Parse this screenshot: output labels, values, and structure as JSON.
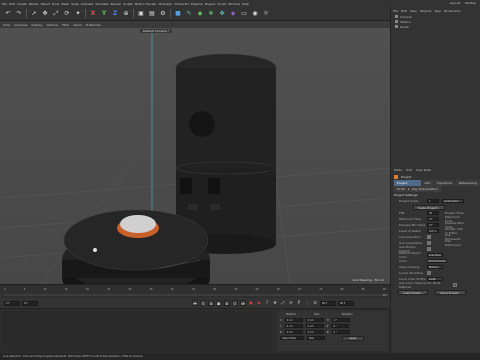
{
  "menubar": {
    "items": [
      "File",
      "Edit",
      "Create",
      "Modes",
      "Select",
      "Tools",
      "Mesh",
      "Snap",
      "Animate",
      "Simulate",
      "Render",
      "Sculpt",
      "Motion Tracker",
      "MoGraph",
      "Character",
      "Pipeline",
      "Plugins",
      "Script",
      "Window",
      "Help"
    ],
    "layout_label": "Layout:",
    "layout_value": "Startup"
  },
  "toolbar": {
    "icons": [
      "undo-icon",
      "redo-icon",
      "live-selection-icon",
      "move-icon",
      "scale-icon",
      "rotate-icon",
      "recent-tools-icon",
      "x-axis-icon",
      "y-axis-icon",
      "z-axis-icon",
      "coordinate-system-icon",
      "render-view-icon",
      "render-picture-viewer-icon",
      "edit-render-settings-icon",
      "cube-icon",
      "pen-icon",
      "subdivision-icon",
      "array-icon",
      "cloner-icon",
      "deformer-icon",
      "floor-icon",
      "camera-icon",
      "light-icon"
    ]
  },
  "viewport": {
    "menu": [
      "View",
      "Cameras",
      "Display",
      "Options",
      "Filter",
      "Panel",
      "ProRender"
    ],
    "camera_label": "Default Camera *",
    "grid_spacing": "Grid Spacing : 50 cm",
    "accent": "#4fa3a3"
  },
  "object_manager": {
    "menu": [
      "File",
      "Edit",
      "View",
      "Objects",
      "Tags",
      "Bookmarks"
    ],
    "objects": [
      {
        "name": "Camera"
      },
      {
        "name": "Station"
      },
      {
        "name": "Robot"
      }
    ]
  },
  "attribute_manager": {
    "menu": [
      "Mode",
      "Edit",
      "User Data"
    ],
    "title": "Project",
    "tabs": [
      "Project Settings",
      "Info",
      "Dynamics",
      "Referencing",
      "To Do",
      "Key Interpolation"
    ],
    "section": "Project Settings",
    "rows": [
      {
        "label": "Project Scale",
        "value": "1",
        "label2": "Centimeters"
      },
      {
        "label": "Scale Project...",
        "value": "",
        "label2": ""
      },
      {
        "label": "FPS",
        "value": "30",
        "label2": "Project Time"
      },
      {
        "label": "Minimum Time",
        "value": "0 F",
        "label2": "Maximum Time"
      },
      {
        "label": "Preview Min Time",
        "value": "0 F",
        "label2": "Preview Max Time"
      },
      {
        "label": "Level of Detail",
        "value": "100 %",
        "label2": "Render LOD in Editor"
      },
      {
        "label": "Use Animation",
        "check": "✓",
        "label2": "Use Expression"
      },
      {
        "label": "Use Generators",
        "check": "✓",
        "label2": "Use Deformers"
      },
      {
        "label": "Use Motion System",
        "check": "✓",
        "label2": ""
      },
      {
        "label": "Default Object Color",
        "value": "Gray Blue",
        "label2": ""
      },
      {
        "label": "Color",
        "value": "",
        "label2": ""
      },
      {
        "label": "View Clipping",
        "value": "Medium",
        "label2": ""
      },
      {
        "label": "Linear Workflow",
        "check": "✓",
        "label2": ""
      },
      {
        "label": "Input Color Profile",
        "value": "sRGB",
        "label2": ""
      },
      {
        "label": "Use Color Channel for Node Material",
        "check": "",
        "label2": ""
      }
    ],
    "buttons": [
      "Load Preset...",
      "Save Preset..."
    ]
  },
  "timeline": {
    "ticks": [
      "0",
      "5",
      "10",
      "15",
      "20",
      "25",
      "30",
      "35",
      "40",
      "45",
      "50",
      "55",
      "60",
      "65",
      "70",
      "75",
      "80",
      "85",
      "90"
    ],
    "frame_end": "90 F"
  },
  "transport": {
    "start": "0 F",
    "current": "0 F",
    "end": "90 F",
    "max": "90 F"
  },
  "coordinates": {
    "headers": [
      "Position",
      "Size",
      "Rotation"
    ],
    "rows": [
      {
        "axis": "X",
        "pos": "0 cm",
        "size": "0 cm",
        "rot_axis": "H",
        "rot": "0 °"
      },
      {
        "axis": "Y",
        "pos": "0 cm",
        "size": "0 cm",
        "rot_axis": "P",
        "rot": "0 °"
      },
      {
        "axis": "Z",
        "pos": "0 cm",
        "size": "0 cm",
        "rot_axis": "B",
        "rot": "0 °"
      }
    ],
    "mode1": "Object (Rel)",
    "mode2": "Size",
    "apply": "Apply"
  },
  "status": {
    "text": "Live Selection: Click and drag to select elements. Hold down SHIFT to add to the selection, CTRL to remove."
  }
}
